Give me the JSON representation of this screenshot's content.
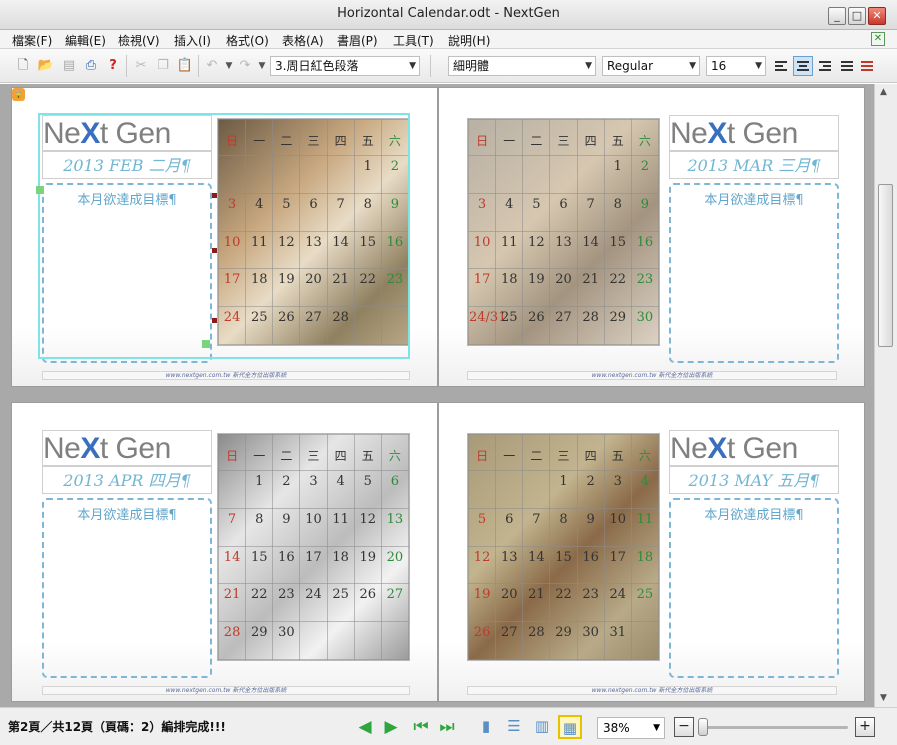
{
  "window": {
    "title": "Horizontal Calendar.odt - NextGen",
    "minimize": "_",
    "maximize": "□",
    "close": "✕"
  },
  "menu": [
    "檔案(F)",
    "編輯(E)",
    "檢視(V)",
    "插入(I)",
    "格式(O)",
    "表格(A)",
    "書眉(P)",
    "工具(T)",
    "說明(H)"
  ],
  "toolbar": {
    "paragraph_style": "3.周日紅色段落",
    "font_name": "細明體",
    "font_style": "Regular",
    "font_size": "16",
    "alignment_selected": "center"
  },
  "weekdays": [
    "日",
    "一",
    "二",
    "三",
    "四",
    "五",
    "六"
  ],
  "goal_label": "本月欲達成目標¶",
  "footer_text": "www.nextgen.com.tw  新代全方位出版系統",
  "pages": [
    {
      "logo_left": "Ne",
      "logo_x": "X",
      "logo_right": "t Gen",
      "month": "2013 FEB 二月¶",
      "weeks": [
        [
          "",
          "",
          "",
          "",
          "",
          "1",
          "2"
        ],
        [
          "3",
          "4",
          "5",
          "6",
          "7",
          "8",
          "9"
        ],
        [
          "10",
          "11",
          "12",
          "13",
          "14",
          "15",
          "16"
        ],
        [
          "17",
          "18",
          "19",
          "20",
          "21",
          "22",
          "23"
        ],
        [
          "24",
          "25",
          "26",
          "27",
          "28",
          "",
          ""
        ]
      ]
    },
    {
      "logo_left": "Ne",
      "logo_x": "X",
      "logo_right": "t Gen",
      "month": "2013 MAR 三月¶",
      "weeks": [
        [
          "",
          "",
          "",
          "",
          "",
          "1",
          "2"
        ],
        [
          "3",
          "4",
          "5",
          "6",
          "7",
          "8",
          "9"
        ],
        [
          "10",
          "11",
          "12",
          "13",
          "14",
          "15",
          "16"
        ],
        [
          "17",
          "18",
          "19",
          "20",
          "21",
          "22",
          "23"
        ],
        [
          "24/31",
          "25",
          "26",
          "27",
          "28",
          "29",
          "30"
        ]
      ]
    },
    {
      "logo_left": "Ne",
      "logo_x": "X",
      "logo_right": "t Gen",
      "month": "2013 APR 四月¶",
      "weeks": [
        [
          "",
          "1",
          "2",
          "3",
          "4",
          "5",
          "6"
        ],
        [
          "7",
          "8",
          "9",
          "10",
          "11",
          "12",
          "13"
        ],
        [
          "14",
          "15",
          "16",
          "17",
          "18",
          "19",
          "20"
        ],
        [
          "21",
          "22",
          "23",
          "24",
          "25",
          "26",
          "27"
        ],
        [
          "28",
          "29",
          "30",
          "",
          "",
          "",
          ""
        ]
      ]
    },
    {
      "logo_left": "Ne",
      "logo_x": "X",
      "logo_right": "t Gen",
      "month": "2013 MAY 五月¶",
      "weeks": [
        [
          "",
          "",
          "",
          "1",
          "2",
          "3",
          "4"
        ],
        [
          "5",
          "6",
          "7",
          "8",
          "9",
          "10",
          "11"
        ],
        [
          "12",
          "13",
          "14",
          "15",
          "16",
          "17",
          "18"
        ],
        [
          "19",
          "20",
          "21",
          "22",
          "23",
          "24",
          "25"
        ],
        [
          "26",
          "27",
          "28",
          "29",
          "30",
          "31",
          ""
        ]
      ]
    }
  ],
  "status": {
    "text": "第2頁／共12頁（頁碼：2）編排完成!!!",
    "zoom": "38%",
    "zoom_minus": "−",
    "zoom_plus": "+"
  },
  "colors": {
    "accent": "#62a7cc",
    "sunday": "#c0392b",
    "saturday": "#2e8b3a",
    "selection": "#7fe4e8"
  }
}
